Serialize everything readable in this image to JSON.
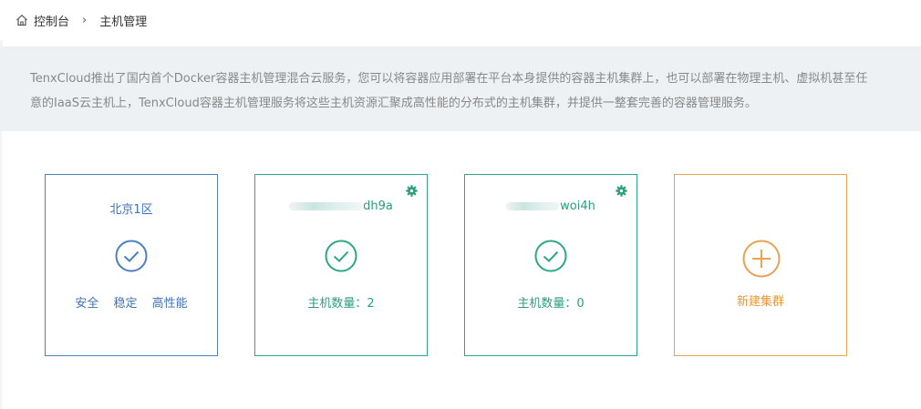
{
  "breadcrumb": {
    "root": "控制台",
    "separator": "›",
    "current": "主机管理"
  },
  "intro": {
    "line1": "TenxCloud推出了国内首个Docker容器主机管理混合云服务，您可以将容器应用部署在平台本身提供的容器主机集群上，也可以部署在物理主机、虚拟机甚至任",
    "line2": "意的IaaS云主机上，TenxCloud容器主机管理服务将这些主机资源汇聚成高性能的分布式的主机集群，并提供一整套完善的容器管理服务。"
  },
  "clusters": [
    {
      "name": "北京1区",
      "features": [
        "安全",
        "稳定",
        "高性能"
      ],
      "color": "#3f72b7"
    },
    {
      "name_suffix": "dh9a",
      "host_count_label": "主机数量：2",
      "color": "#2a9e7c"
    },
    {
      "name_suffix": "woi4h",
      "host_count_label": "主机数量：0",
      "color": "#2a9e7c"
    }
  ],
  "new_cluster": {
    "label": "新建集群",
    "color": "#e79634"
  },
  "icons": {
    "home": "home-icon",
    "chevron": "chevron-right-icon",
    "check": "check-circle-icon",
    "gear": "gear-icon",
    "plus": "plus-circle-icon"
  }
}
